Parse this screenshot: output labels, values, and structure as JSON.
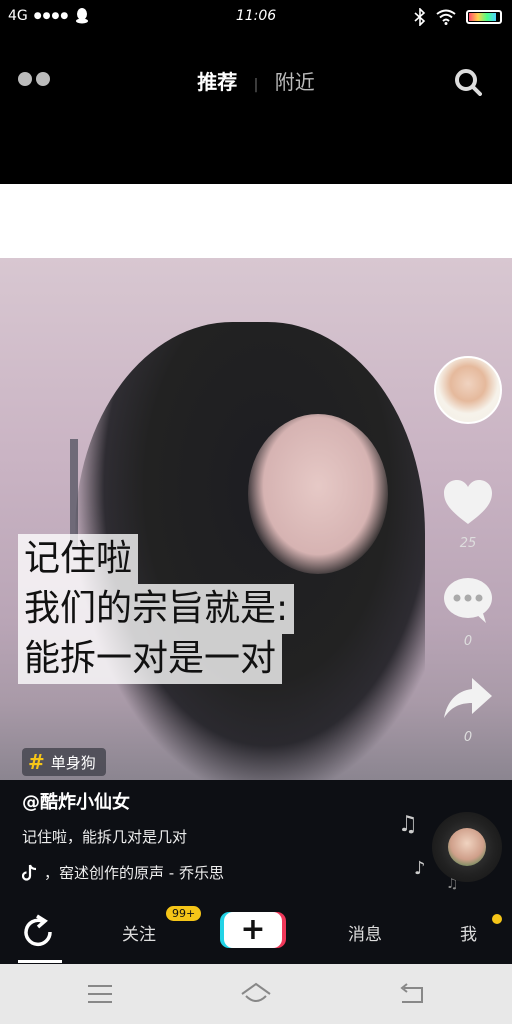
{
  "status_bar": {
    "network": "4G",
    "signal": "●●●●",
    "time": "11:06",
    "battery_level": 0.9
  },
  "header": {
    "tabs": [
      {
        "label": "推荐",
        "active": true
      },
      {
        "label": "附近",
        "active": false
      }
    ],
    "icons": [
      "live-dots-icon",
      "search-icon"
    ]
  },
  "video": {
    "caption_lines": [
      "记住啦",
      "我们的宗旨就是:",
      "能拆一对是一对"
    ],
    "hashtag": "单身狗"
  },
  "side_actions": {
    "likes": "25",
    "comments": "0",
    "shares": "0"
  },
  "post": {
    "username": "@酷炸小仙女",
    "description": "记住啦，能拆几对是几对",
    "music": "，窑述创作的原声 - 乔乐思"
  },
  "bottom_nav": {
    "follow_label": "关注",
    "follow_badge": "99+",
    "messages_label": "消息",
    "me_label": "我"
  },
  "colors": {
    "accent": "#f5c518",
    "cyan": "#22d3e6",
    "red": "#f0385a",
    "background": "#0d0f14"
  }
}
